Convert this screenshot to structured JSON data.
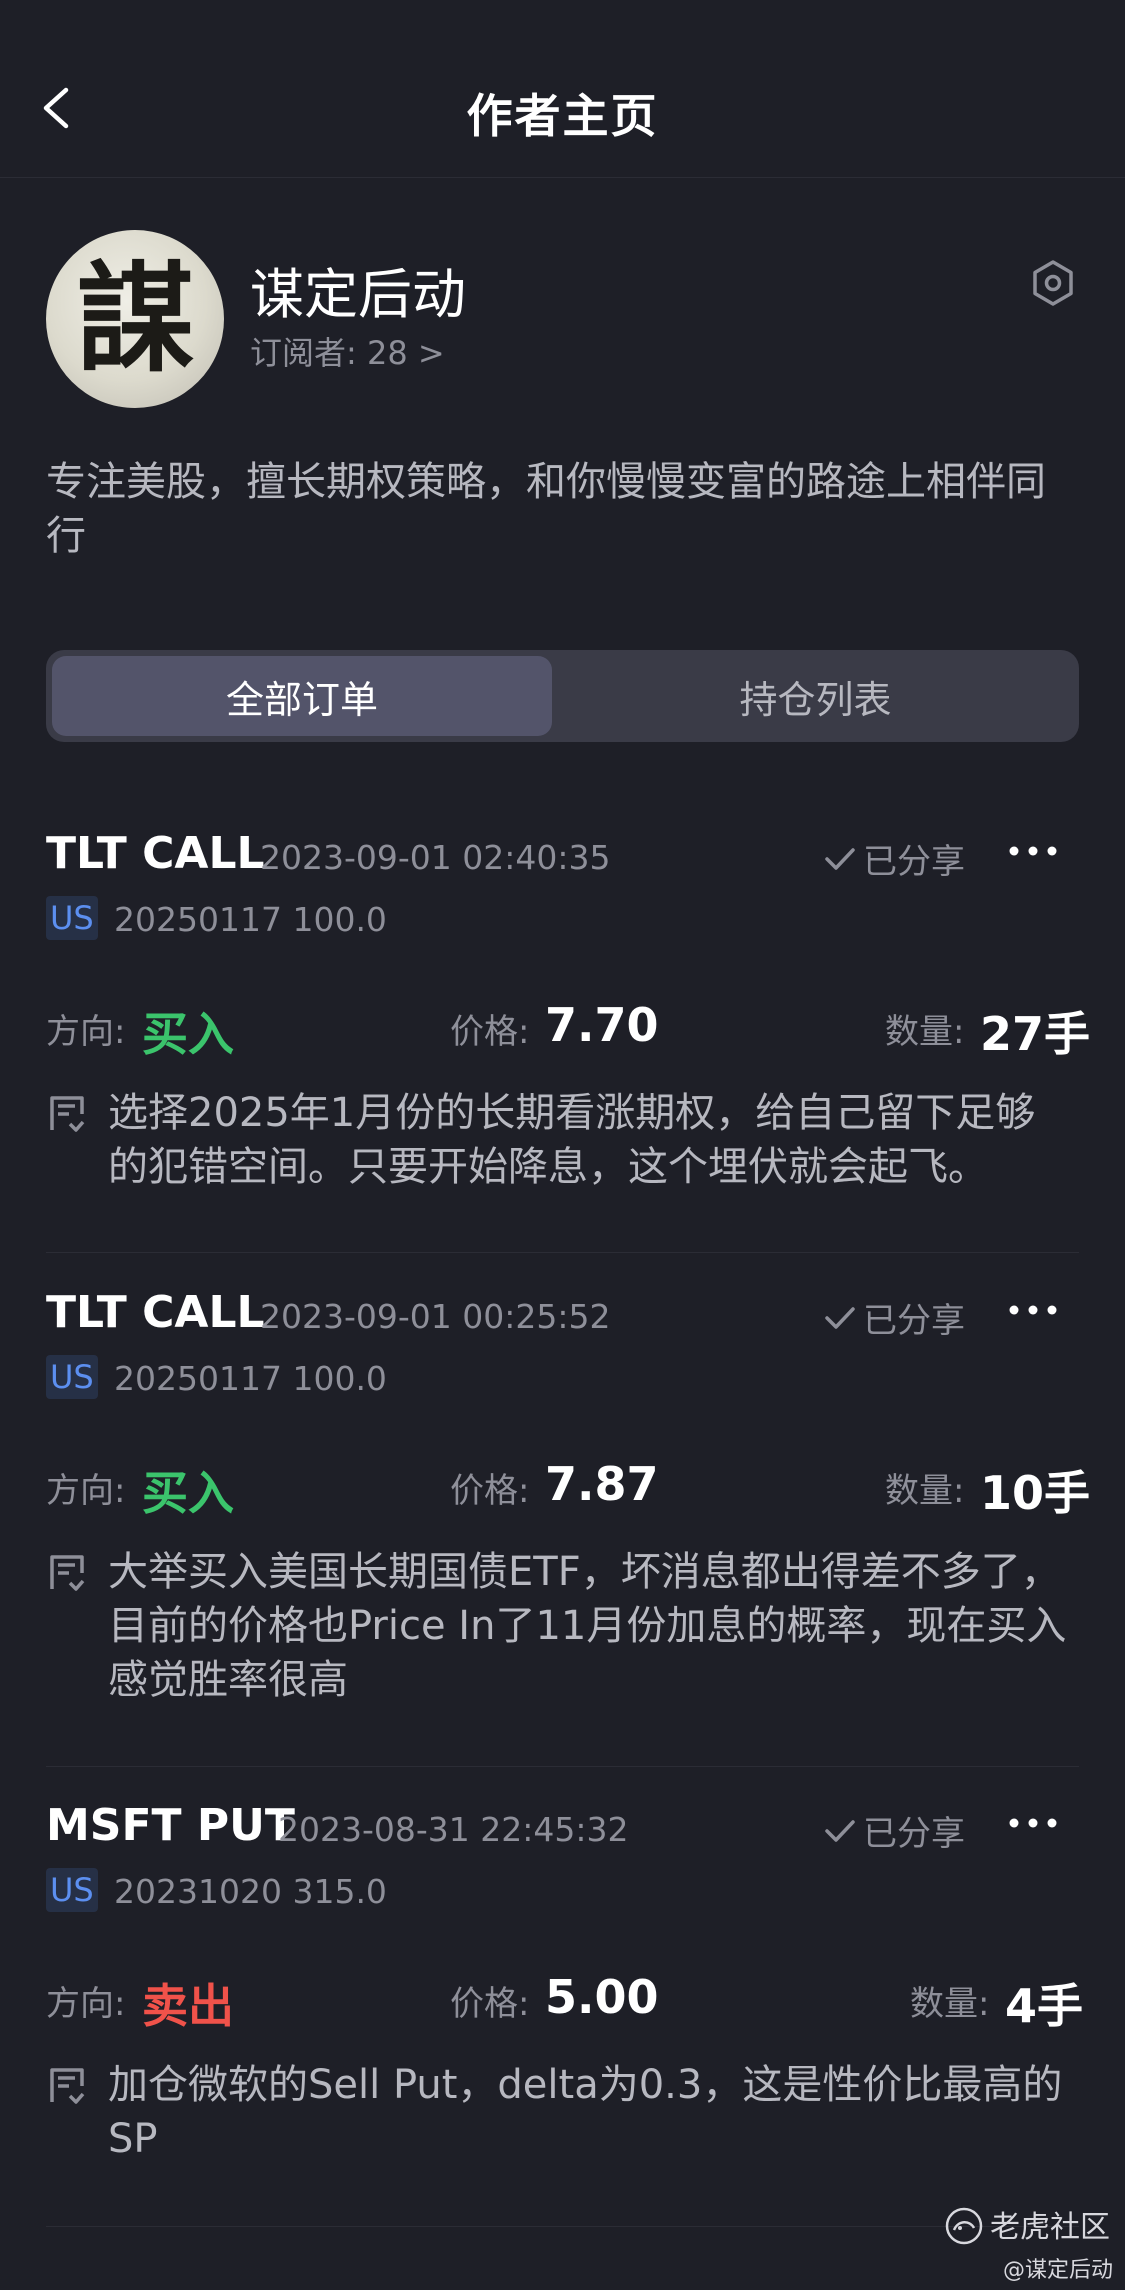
{
  "header": {
    "title": "作者主页",
    "back_icon": "chevron-left-icon"
  },
  "profile": {
    "avatar_glyph": "謀",
    "name": "谋定后动",
    "subscribers": "订阅者: 28 >",
    "settings_icon": "hexagon-settings-icon",
    "bio": "专注美股，擅长期权策略，和你慢慢变富的路途上相伴同行"
  },
  "tabs": [
    {
      "label": "全部订单",
      "active": true
    },
    {
      "label": "持仓列表",
      "active": false
    }
  ],
  "labels": {
    "direction": "方向:",
    "price": "价格:",
    "quantity": "数量:"
  },
  "orders": [
    {
      "symbol": "TLT CALL",
      "timestamp": "2023-09-01 02:40:35",
      "shared": "已分享",
      "market": "US",
      "contract": "20250117 100.0",
      "direction": "买入",
      "price": "7.70",
      "quantity": "27手",
      "note": "选择2025年1月份的长期看涨期权，给自己留下足够的犯错空间。只要开始降息，这个埋伏就会起飞。"
    },
    {
      "symbol": "TLT CALL",
      "timestamp": "2023-09-01 00:25:52",
      "shared": "已分享",
      "market": "US",
      "contract": "20250117 100.0",
      "direction": "买入",
      "price": "7.87",
      "quantity": "10手",
      "note": "大举买入美国长期国债ETF，坏消息都出得差不多了，目前的价格也Price In了11月份加息的概率，现在买入感觉胜率很高"
    },
    {
      "symbol": "MSFT PUT",
      "timestamp": "2023-08-31 22:45:32",
      "shared": "已分享",
      "market": "US",
      "contract": "20231020 315.0",
      "direction": "卖出",
      "price": "5.00",
      "quantity": "4手",
      "note": "加仓微软的Sell Put，delta为0.3，这是性价比最高的SP"
    }
  ],
  "colors": {
    "buy": "#3bc46c",
    "sell": "#f0524a",
    "badge": "#5c8ff0",
    "background": "#1e1f27"
  },
  "watermark": {
    "title": "老虎社区",
    "user": "@谋定后动"
  }
}
